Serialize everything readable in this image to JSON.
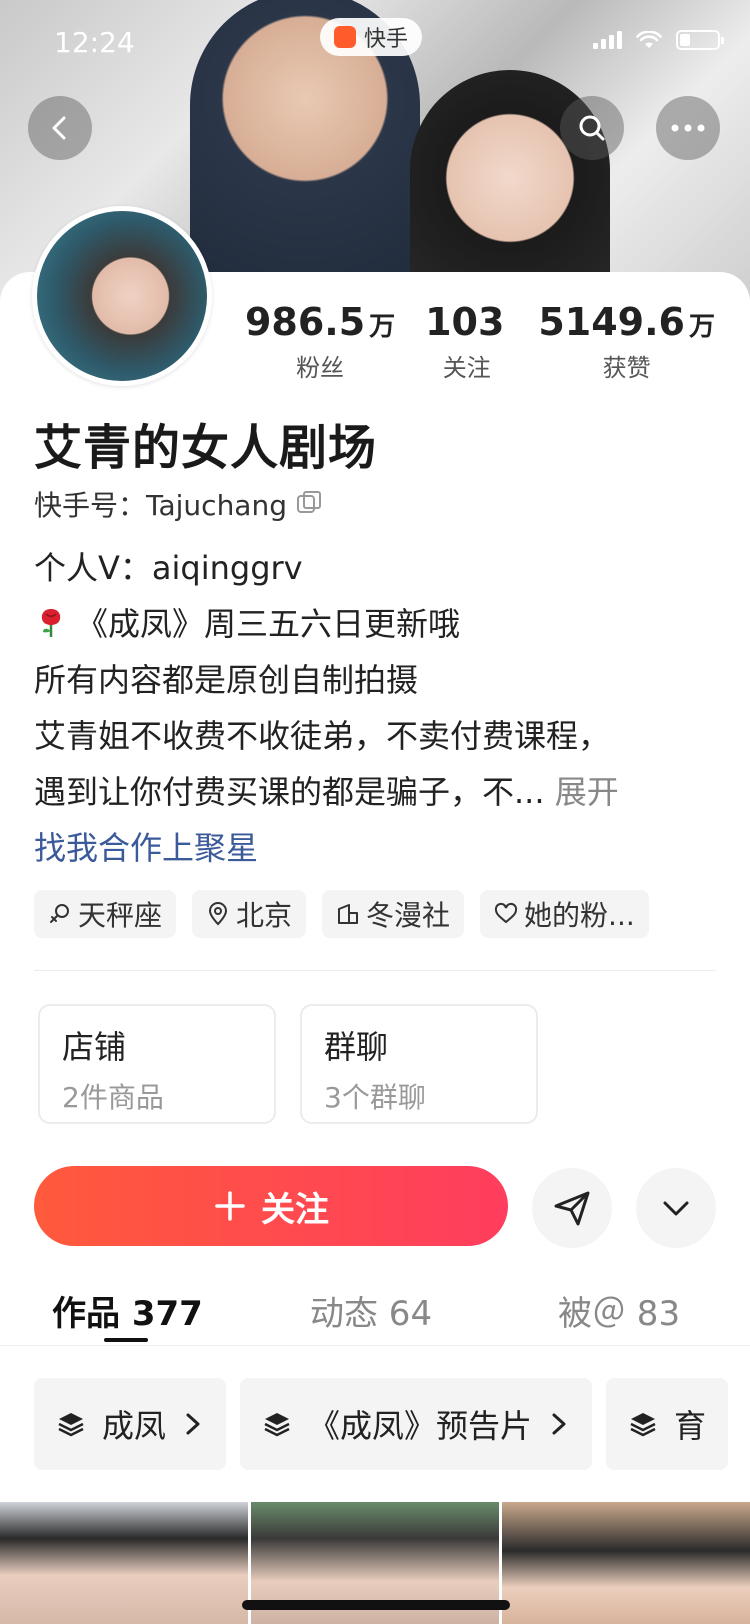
{
  "status": {
    "time": "12:24",
    "app_name": "快手"
  },
  "profile": {
    "name": "艾青的女人剧场",
    "kuaishou_id_label": "快手号：",
    "kuaishou_id": "Tajuchang",
    "stats": [
      {
        "value": "986.5",
        "unit": "万",
        "label": "粉丝"
      },
      {
        "value": "103",
        "unit": "",
        "label": "关注"
      },
      {
        "value": "5149.6",
        "unit": "万",
        "label": "获赞"
      }
    ],
    "bio": {
      "line1": "个人V：aiqinggrv",
      "line2": "《成凤》周三五六日更新哦",
      "line3": "所有内容都是原创自制拍摄",
      "line4": "艾青姐不收费不收徒弟，不卖付费课程，",
      "line5": "遇到让你付费买课的都是骗子，不...",
      "expand": "展开",
      "link": "找我合作上聚星"
    },
    "tags": [
      {
        "icon": "female-icon",
        "label": "天秤座"
      },
      {
        "icon": "location-icon",
        "label": "北京"
      },
      {
        "icon": "building-icon",
        "label": "冬漫社"
      },
      {
        "icon": "heart-icon",
        "label": "她的粉..."
      }
    ]
  },
  "boxes": [
    {
      "title": "店铺",
      "sub": "2件商品"
    },
    {
      "title": "群聊",
      "sub": "3个群聊"
    }
  ],
  "actions": {
    "follow": "关注"
  },
  "tabs": [
    {
      "label": "作品 377"
    },
    {
      "label": "动态 64"
    },
    {
      "label": "被＠ 83"
    }
  ],
  "collections": [
    {
      "label": "成凤"
    },
    {
      "label": "《成凤》预告片"
    },
    {
      "label": "育"
    }
  ],
  "colors": {
    "follow_gradient_start": "#ff5a3c",
    "follow_gradient_end": "#ff3d5e",
    "link": "#3b5a9a"
  }
}
